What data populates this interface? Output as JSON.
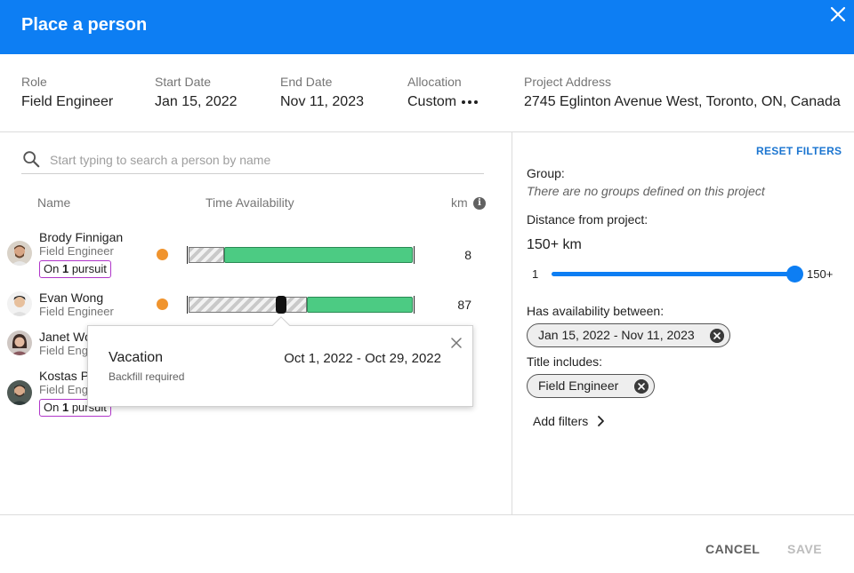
{
  "header": {
    "title": "Place a person"
  },
  "role": {
    "label": "Role",
    "value": "Field Engineer"
  },
  "start_date": {
    "label": "Start Date",
    "value": "Jan 15, 2022"
  },
  "end_date": {
    "label": "End Date",
    "value": "Nov 11, 2023"
  },
  "allocation": {
    "label": "Allocation",
    "value": "Custom"
  },
  "address": {
    "label": "Project Address",
    "value": "2745 Eglinton Avenue West, Toronto, ON, Canada"
  },
  "search": {
    "placeholder": "Start typing to search a person by name"
  },
  "columns": {
    "name": "Name",
    "time": "Time Availability",
    "km": "km"
  },
  "people": [
    {
      "name": "Brody Finnigan",
      "title": "Field Engineer",
      "pursuit_prefix": "On ",
      "pursuit_count": "1",
      "pursuit_suffix": " pursuit",
      "km": "8"
    },
    {
      "name": "Evan Wong",
      "title": "Field Engineer",
      "km": "87"
    },
    {
      "name": "Janet Wo",
      "title": "Field Eng"
    },
    {
      "name": "Kostas P",
      "title": "Field Eng",
      "pursuit_prefix": "On ",
      "pursuit_count": "1",
      "pursuit_suffix": " pursuit"
    }
  ],
  "popup": {
    "title": "Vacation",
    "subtitle": "Backfill required",
    "range": "Oct 1, 2022 - Oct 29, 2022"
  },
  "filters": {
    "reset": "RESET FILTERS",
    "group_label": "Group:",
    "group_note": "There are no groups defined on this project",
    "distance_label": "Distance from project:",
    "distance_value": "150+ km",
    "slider_min": "1",
    "slider_max": "150+",
    "slider_level": 1.0,
    "availability_label": "Has availability between:",
    "availability_chip": "Jan 15, 2022 - Nov 11, 2023",
    "title_label": "Title includes:",
    "title_chip": "Field Engineer",
    "add_filters": "Add filters"
  },
  "footer": {
    "cancel": "CANCEL",
    "save": "SAVE"
  },
  "colors": {
    "header": "#0d7ef3",
    "available": "#4ccb83",
    "status_dot": "#f0942e",
    "pursuit_border": "#b036c9",
    "link": "#1b75d0"
  },
  "icons": [
    "close-icon",
    "search-icon",
    "info-icon",
    "more-horiz-icon",
    "chevron-right-icon",
    "chip-clear-icon"
  ]
}
